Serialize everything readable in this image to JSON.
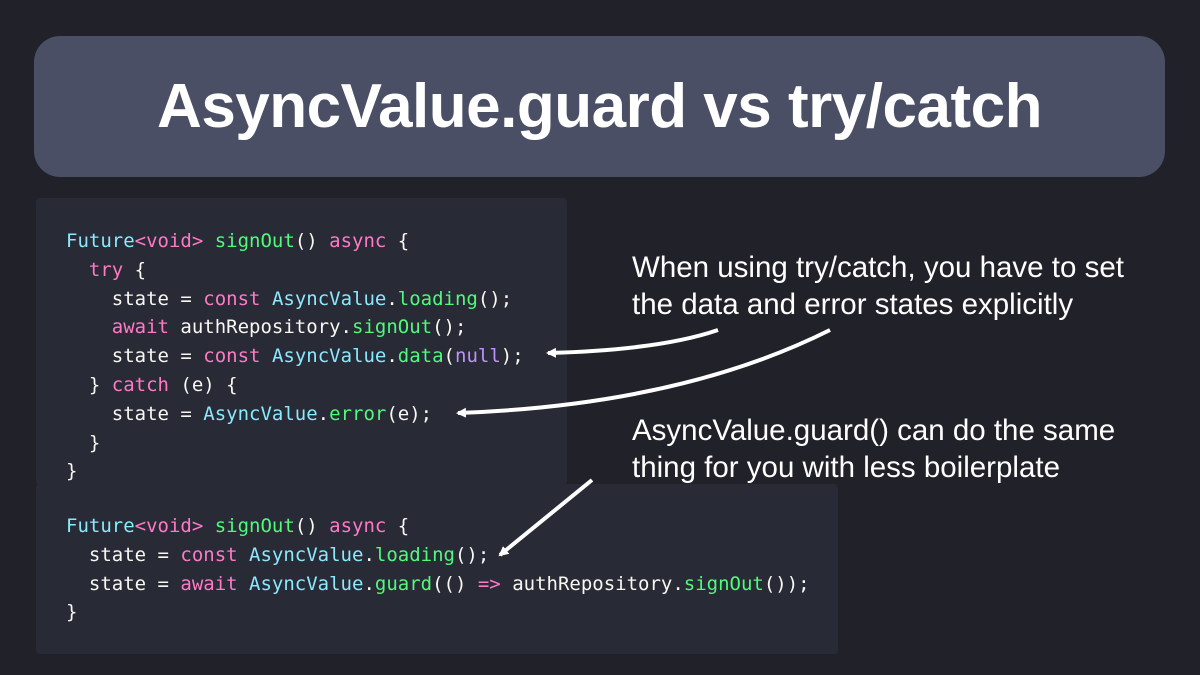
{
  "title": "AsyncValue.guard vs try/catch",
  "code_top": [
    [
      [
        "type",
        "Future"
      ],
      [
        "kw",
        "<void>"
      ],
      [
        "plain",
        " "
      ],
      [
        "fn",
        "signOut"
      ],
      [
        "plain",
        "() "
      ],
      [
        "kw",
        "async"
      ],
      [
        "plain",
        " {"
      ]
    ],
    [
      [
        "plain",
        "  "
      ],
      [
        "kw",
        "try"
      ],
      [
        "plain",
        " {"
      ]
    ],
    [
      [
        "plain",
        "    state = "
      ],
      [
        "kw",
        "const"
      ],
      [
        "plain",
        " "
      ],
      [
        "type",
        "AsyncValue"
      ],
      [
        "plain",
        "."
      ],
      [
        "fn",
        "loading"
      ],
      [
        "plain",
        "();"
      ]
    ],
    [
      [
        "plain",
        "    "
      ],
      [
        "kw",
        "await"
      ],
      [
        "plain",
        " authRepository."
      ],
      [
        "fn",
        "signOut"
      ],
      [
        "plain",
        "();"
      ]
    ],
    [
      [
        "plain",
        "    state = "
      ],
      [
        "kw",
        "const"
      ],
      [
        "plain",
        " "
      ],
      [
        "type",
        "AsyncValue"
      ],
      [
        "plain",
        "."
      ],
      [
        "fn",
        "data"
      ],
      [
        "plain",
        "("
      ],
      [
        "null",
        "null"
      ],
      [
        "plain",
        ");"
      ]
    ],
    [
      [
        "plain",
        "  } "
      ],
      [
        "kw",
        "catch"
      ],
      [
        "plain",
        " (e) {"
      ]
    ],
    [
      [
        "plain",
        "    state = "
      ],
      [
        "type",
        "AsyncValue"
      ],
      [
        "plain",
        "."
      ],
      [
        "fn",
        "error"
      ],
      [
        "plain",
        "(e);"
      ]
    ],
    [
      [
        "plain",
        "  }"
      ]
    ],
    [
      [
        "plain",
        "}"
      ]
    ]
  ],
  "code_bottom": [
    [
      [
        "type",
        "Future"
      ],
      [
        "kw",
        "<void>"
      ],
      [
        "plain",
        " "
      ],
      [
        "fn",
        "signOut"
      ],
      [
        "plain",
        "() "
      ],
      [
        "kw",
        "async"
      ],
      [
        "plain",
        " {"
      ]
    ],
    [
      [
        "plain",
        "  state = "
      ],
      [
        "kw",
        "const"
      ],
      [
        "plain",
        " "
      ],
      [
        "type",
        "AsyncValue"
      ],
      [
        "plain",
        "."
      ],
      [
        "fn",
        "loading"
      ],
      [
        "plain",
        "();"
      ]
    ],
    [
      [
        "plain",
        "  state = "
      ],
      [
        "kw",
        "await"
      ],
      [
        "plain",
        " "
      ],
      [
        "type",
        "AsyncValue"
      ],
      [
        "plain",
        "."
      ],
      [
        "fn",
        "guard"
      ],
      [
        "plain",
        "(() "
      ],
      [
        "kw",
        "=>"
      ],
      [
        "plain",
        " authRepository."
      ],
      [
        "fn",
        "signOut"
      ],
      [
        "plain",
        "());"
      ]
    ],
    [
      [
        "plain",
        "}"
      ]
    ]
  ],
  "callouts": {
    "try_catch": [
      "When using try/catch, you have to set",
      "the data and error states explicitly"
    ],
    "guard": [
      "AsyncValue.guard() can do the same",
      "thing for you with less boilerplate"
    ]
  },
  "colors": {
    "background": "#212129",
    "title_box": "#4b4f66",
    "code_panel": "#282a36",
    "type": "#8be9fd",
    "keyword": "#ff79c6",
    "function": "#50fa7b",
    "null": "#bd93f9",
    "text": "#f8f8f2"
  }
}
